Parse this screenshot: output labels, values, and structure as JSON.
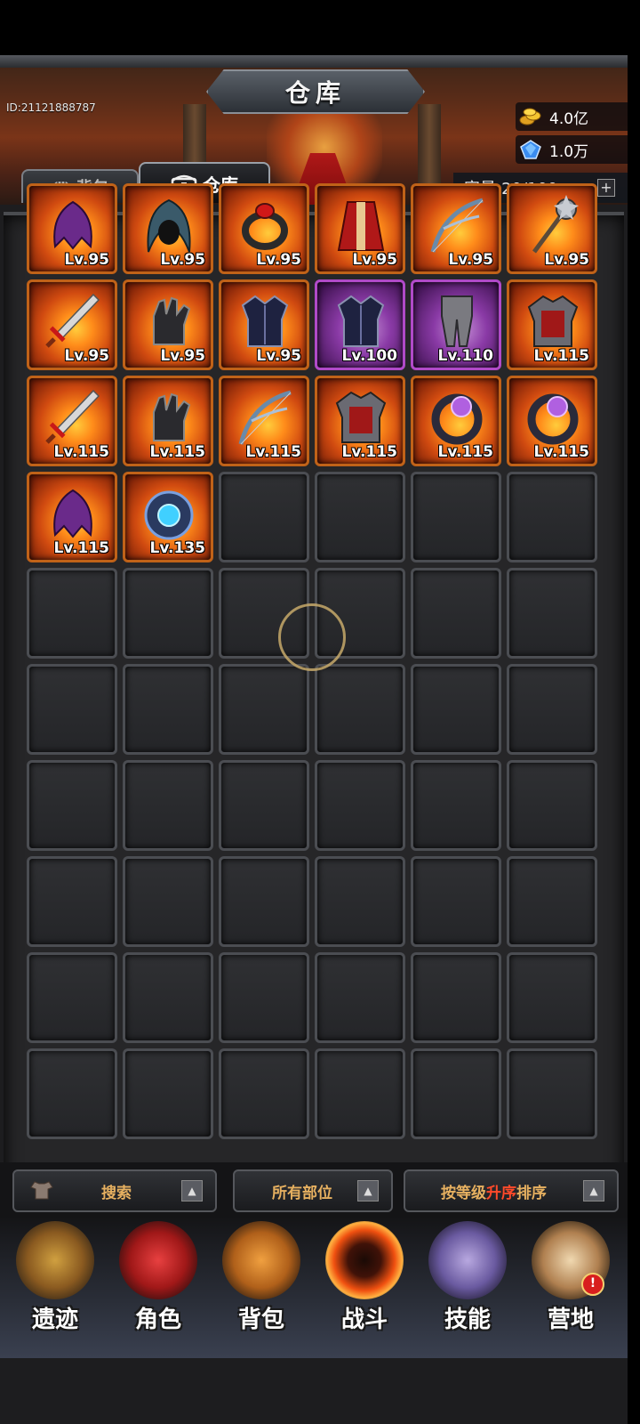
{
  "window": {
    "title": "仓库"
  },
  "player": {
    "id": "ID:21121888787"
  },
  "currency": {
    "gold": "4.0亿",
    "gems": "1.0万"
  },
  "tabs": [
    {
      "label": "背包"
    },
    {
      "label": "仓库"
    }
  ],
  "capacity": {
    "label": "容量:20/100",
    "add": "+"
  },
  "items": [
    {
      "level": "Lv.95",
      "rarity": "orange",
      "icon": "dark-helm-icon"
    },
    {
      "level": "Lv.95",
      "rarity": "orange",
      "icon": "hood-icon"
    },
    {
      "level": "Lv.95",
      "rarity": "orange",
      "icon": "ring-icon"
    },
    {
      "level": "Lv.95",
      "rarity": "orange",
      "icon": "robe-icon"
    },
    {
      "level": "Lv.95",
      "rarity": "orange",
      "icon": "bow-icon"
    },
    {
      "level": "Lv.95",
      "rarity": "orange",
      "icon": "mace-icon"
    },
    {
      "level": "Lv.95",
      "rarity": "orange",
      "icon": "sword-icon"
    },
    {
      "level": "Lv.95",
      "rarity": "orange",
      "icon": "gauntlet-icon"
    },
    {
      "level": "Lv.95",
      "rarity": "orange",
      "icon": "chest-armor-icon"
    },
    {
      "level": "Lv.100",
      "rarity": "purple",
      "icon": "chest-armor-icon"
    },
    {
      "level": "Lv.110",
      "rarity": "purple",
      "icon": "leg-armor-icon"
    },
    {
      "level": "Lv.115",
      "rarity": "orange",
      "icon": "plate-armor-icon"
    },
    {
      "level": "Lv.115",
      "rarity": "orange",
      "icon": "sword-icon"
    },
    {
      "level": "Lv.115",
      "rarity": "orange",
      "icon": "gauntlet-icon"
    },
    {
      "level": "Lv.115",
      "rarity": "orange",
      "icon": "bow-icon"
    },
    {
      "level": "Lv.115",
      "rarity": "orange",
      "icon": "plate-armor-icon"
    },
    {
      "level": "Lv.115",
      "rarity": "orange",
      "icon": "amulet-icon"
    },
    {
      "level": "Lv.115",
      "rarity": "orange",
      "icon": "amulet-icon"
    },
    {
      "level": "Lv.115",
      "rarity": "orange",
      "icon": "dark-helm-icon"
    },
    {
      "level": "Lv.135",
      "rarity": "orange",
      "icon": "orb-icon"
    }
  ],
  "slots": {
    "total": 60
  },
  "filters": {
    "search": "搜索",
    "slot": "所有部位",
    "sort_prefix": "按等级",
    "sort_highlight": "升序",
    "sort_suffix": "排序"
  },
  "nav": [
    {
      "label": "遗迹",
      "icon": "relic-icon"
    },
    {
      "label": "角色",
      "icon": "character-icon"
    },
    {
      "label": "背包",
      "icon": "backpack-icon"
    },
    {
      "label": "战斗",
      "icon": "battle-icon"
    },
    {
      "label": "技能",
      "icon": "skill-book-icon"
    },
    {
      "label": "营地",
      "icon": "camp-icon"
    }
  ],
  "nav_badge": "!",
  "colors": {
    "orange_rarity": "#c06218",
    "purple_rarity": "#b04ac8",
    "highlight": "#ff4a2a",
    "filter_text": "#e6b060"
  }
}
